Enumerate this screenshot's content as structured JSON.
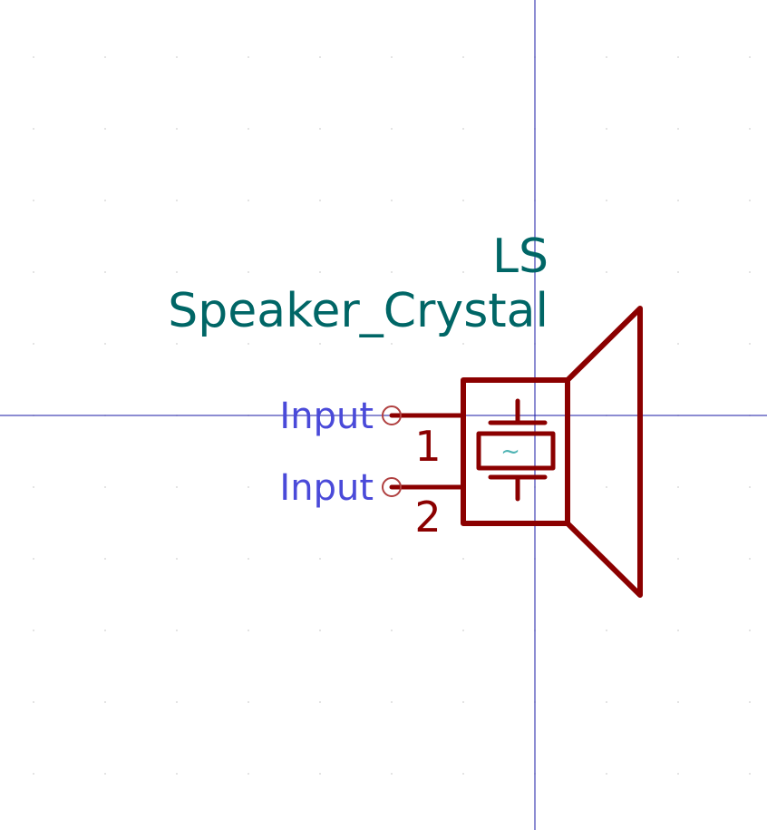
{
  "symbol": {
    "reference": "LS",
    "value": "Speaker_Crystal",
    "pins": [
      {
        "number": "1",
        "name": "Input"
      },
      {
        "number": "2",
        "name": "Input"
      }
    ],
    "element_glyph": "~",
    "symbol_icon": "crystal-speaker-icon"
  },
  "colors": {
    "background": "#ffffff",
    "symbol_body": "#8b0000",
    "field_text": "#006666",
    "pin_name_text": "#4a4ad9",
    "crosshair": "#1a1aa6",
    "crystal_glyph": "#4db3b3"
  }
}
